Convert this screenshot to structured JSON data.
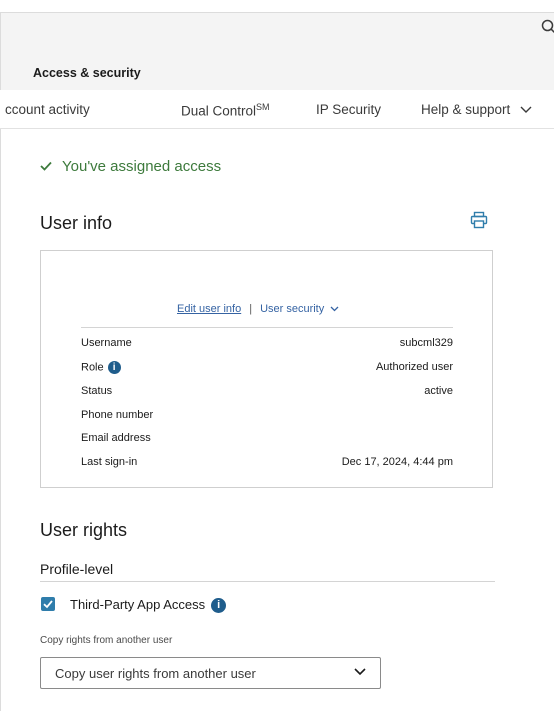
{
  "header": {
    "breadcrumb": "Access & security"
  },
  "nav": {
    "items": [
      {
        "label": "ccount activity"
      },
      {
        "label": "Dual Control",
        "sup": "SM"
      },
      {
        "label": "IP Security"
      },
      {
        "label": "Help & support"
      }
    ]
  },
  "status": {
    "message": "You've assigned access"
  },
  "user_info": {
    "title": "User info",
    "edit_link": "Edit user info",
    "separator": "|",
    "security_link": "User security",
    "rows": [
      {
        "label": "Username",
        "value": "subcml329"
      },
      {
        "label": "Role",
        "value": "Authorized user"
      },
      {
        "label": "Status",
        "value": "active"
      },
      {
        "label": "Phone number",
        "value": ""
      },
      {
        "label": "Email address",
        "value": ""
      },
      {
        "label": "Last sign-in",
        "value": "Dec 17, 2024, 4:44 pm"
      }
    ]
  },
  "user_rights": {
    "title": "User rights",
    "profile_level": "Profile-level",
    "third_party": {
      "label": "Third-Party App Access",
      "checked": true
    },
    "copy_label": "Copy rights from another user",
    "copy_select_value": "Copy user rights from another user"
  },
  "colors": {
    "accent_blue": "#2f7dab",
    "success_green": "#3d7a3c",
    "link_blue": "#3563a3"
  }
}
